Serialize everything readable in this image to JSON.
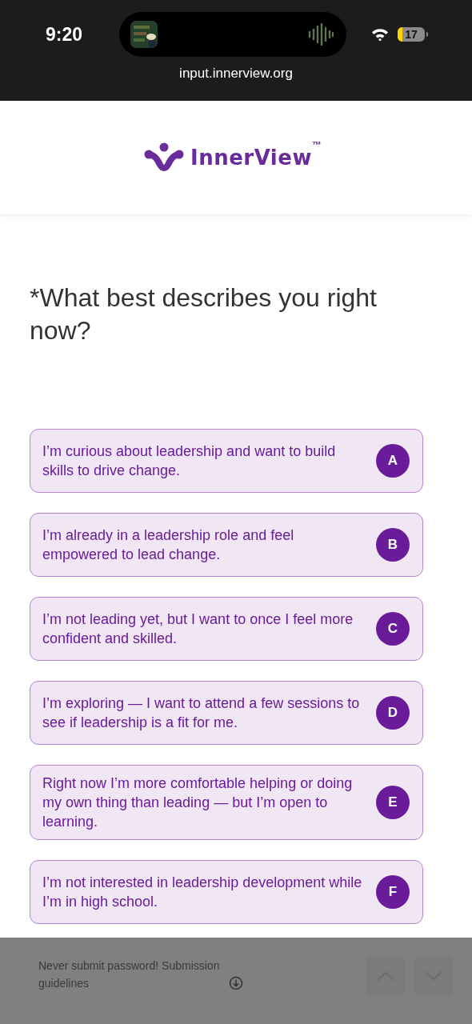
{
  "status_bar": {
    "time": "9:20",
    "battery": "17"
  },
  "browser": {
    "url": "input.innerview.org"
  },
  "logo": {
    "name": "InnerView",
    "mark": "™"
  },
  "question": {
    "title": "*What best describes you right now?"
  },
  "options": [
    {
      "key": "A",
      "text": "I’m curious about leadership and want to build skills to drive change.",
      "selected": false
    },
    {
      "key": "B",
      "text": "I’m already in a leadership role and feel empowered to lead change.",
      "selected": false
    },
    {
      "key": "C",
      "text": "I’m not leading yet, but I want to once I feel more confident and skilled.",
      "selected": false
    },
    {
      "key": "D",
      "text": "I’m exploring — I want to attend a few sessions to see if leadership is a fit for me.",
      "selected": false
    },
    {
      "key": "E",
      "text": "Right now I’m more comfortable helping or doing my own thing than leading — but I’m open to learning.",
      "selected": false
    },
    {
      "key": "F",
      "text": "I’m not interested in leadership development while I’m in high school.",
      "selected": false
    }
  ],
  "footer": {
    "notice": "Never submit password! Submission guidelines",
    "prev_disabled": true,
    "next_disabled": true
  }
}
